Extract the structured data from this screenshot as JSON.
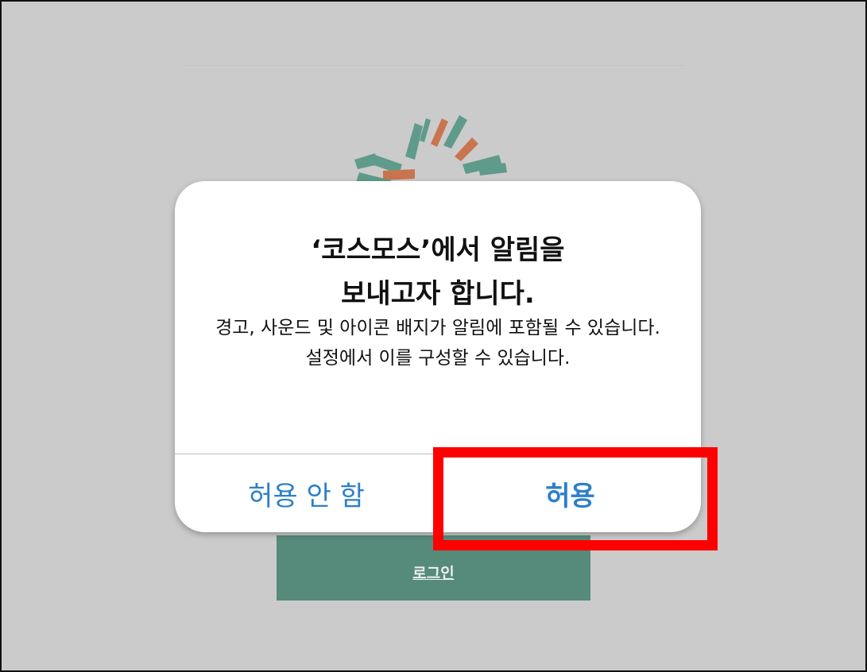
{
  "background": {
    "login_label": "로그인",
    "login_color": "#568a7b"
  },
  "dialog": {
    "title": "‘코스모스’에서 알림을\n보내고자 합니다.",
    "message": "경고, 사운드 및 아이콘 배지가 알림에 포함될 수 있습니다. 설정에서 이를 구성할 수 있습니다.",
    "deny_label": "허용 안 함",
    "allow_label": "허용",
    "button_color": "#2d7fca"
  },
  "annotation": {
    "highlight_color": "#ff0000",
    "highlight_target": "allow-button"
  },
  "logo": {
    "icon": "cosmos-flower-logo",
    "colors": [
      "#5f9b8a",
      "#c8754f"
    ]
  }
}
